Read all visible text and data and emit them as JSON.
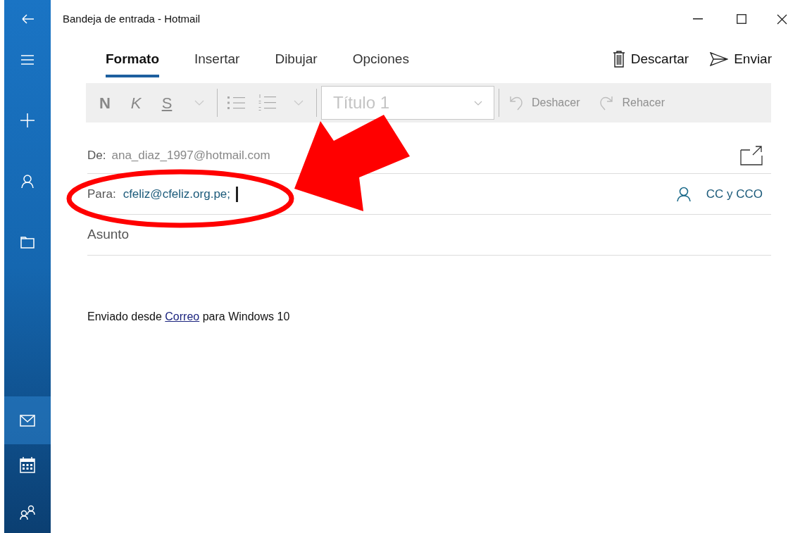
{
  "window": {
    "title": "Bandeja de entrada - Hotmail"
  },
  "sidebar": {
    "items": [
      {
        "kind": "back",
        "selected": false
      },
      {
        "kind": "menu",
        "selected": false
      },
      {
        "kind": "compose",
        "selected": false
      },
      {
        "kind": "accounts",
        "selected": false
      },
      {
        "kind": "folders",
        "selected": false
      },
      {
        "kind": "mail",
        "selected": true
      },
      {
        "kind": "calendar",
        "selected": false
      },
      {
        "kind": "people",
        "selected": false
      }
    ]
  },
  "tabs": [
    {
      "label": "Formato",
      "selected": true
    },
    {
      "label": "Insertar",
      "selected": false
    },
    {
      "label": "Dibujar",
      "selected": false
    },
    {
      "label": "Opciones",
      "selected": false
    }
  ],
  "actions": [
    {
      "kind": "discard",
      "label": "Descartar"
    },
    {
      "kind": "send",
      "label": "Enviar"
    }
  ],
  "toolbar": {
    "format_buttons": [
      {
        "kind": "bold",
        "label": "N"
      },
      {
        "kind": "italic",
        "label": "K"
      },
      {
        "kind": "underline",
        "label": "S"
      }
    ],
    "style": {
      "placeholder": "Título 1"
    },
    "history": [
      {
        "kind": "undo",
        "label": "Deshacer",
        "disabled": true
      },
      {
        "kind": "redo",
        "label": "Rehacer",
        "disabled": true
      }
    ]
  },
  "from": {
    "label": "De:",
    "value": "ana_diaz_1997@hotmail.com"
  },
  "to": {
    "label": "Para:",
    "value": "cfeliz@cfeliz.org.pe;"
  },
  "cc_link": "CC y CCO",
  "subject": {
    "placeholder": "Asunto"
  },
  "signature": {
    "before": "Enviado desde",
    "link": "Correo",
    "after": "para Windows 10"
  }
}
